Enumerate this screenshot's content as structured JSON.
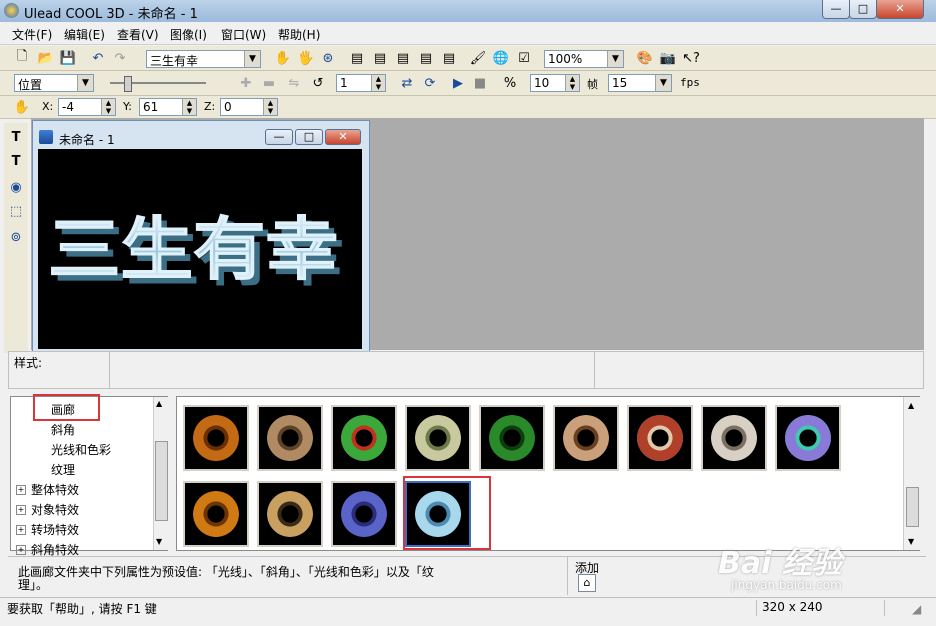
{
  "window": {
    "title": "Ulead COOL 3D - 未命名 - 1",
    "min": "—",
    "max": "□",
    "close": "✕"
  },
  "menu": [
    "文件(F)",
    "编辑(E)",
    "查看(V)",
    "图像(I)",
    "窗口(W)",
    "帮助(H)"
  ],
  "toolbar1": {
    "object_combo": "三生有幸",
    "zoom_combo": "100%"
  },
  "toolbar2": {
    "mode_combo": "位置",
    "frame": "1",
    "frame_count": "10",
    "frame_label": "帧",
    "fps": "15",
    "fps_label": "fps"
  },
  "toolbar3": {
    "x_label": "X:",
    "x": "-4",
    "y_label": "Y:",
    "y": "61",
    "z_label": "Z:",
    "z": "0"
  },
  "document": {
    "title": "未命名 - 1",
    "text": "三生有幸"
  },
  "style_bar": {
    "label": "样式:"
  },
  "tree": {
    "items": [
      {
        "label": "画廊",
        "indent": 2,
        "selected": true
      },
      {
        "label": "斜角",
        "indent": 2
      },
      {
        "label": "光线和色彩",
        "indent": 2
      },
      {
        "label": "纹理",
        "indent": 2
      },
      {
        "label": "整体特效",
        "indent": 1,
        "expandable": true
      },
      {
        "label": "对象特效",
        "indent": 1,
        "expandable": true
      },
      {
        "label": "转场特效",
        "indent": 1,
        "expandable": true
      },
      {
        "label": "斜角特效",
        "indent": 1,
        "expandable": true
      }
    ]
  },
  "gallery": {
    "thumbnails": [
      {
        "color": "#c46a14",
        "inner": "#6b2f04"
      },
      {
        "color": "#b08a62",
        "inner": "#5e4328"
      },
      {
        "color": "#3aa83a",
        "inner": "#c0321e"
      },
      {
        "color": "#c9c9a0",
        "inner": "#6f7a4a"
      },
      {
        "color": "#2a8a2a",
        "inner": "#0e3d0e"
      },
      {
        "color": "#c9a07a",
        "inner": "#6b3f22"
      },
      {
        "color": "#b0402a",
        "inner": "#e0c8a8"
      },
      {
        "color": "#d8d0c4",
        "inner": "#7a6f60"
      },
      {
        "color": "#8a7ad8",
        "inner": "#40c8b0"
      },
      {
        "color": "#d07a14",
        "inner": "#6b3504"
      },
      {
        "color": "#c8a060",
        "inner": "#3a2a1a"
      },
      {
        "color": "#5a64c8",
        "inner": "#2a2e7a"
      },
      {
        "color": "#a8d8ec",
        "inner": "#4c8cb0",
        "selected": true
      }
    ]
  },
  "description": {
    "text_line1": "此画廊文件夹中下列属性为预设值: 「光线」、「斜角」、「光线和色彩」以及「纹",
    "text_line2": "理」。",
    "add_label": "添加"
  },
  "status": {
    "help": "要获取「帮助」, 请按 F1 键",
    "size": "320 x 240"
  },
  "watermark": {
    "text": "Bai 经验",
    "sub": "jingyan.baidu.com"
  }
}
